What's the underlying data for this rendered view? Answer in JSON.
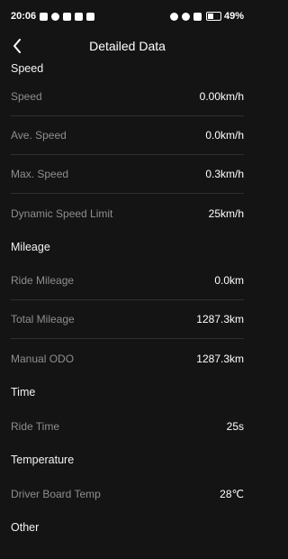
{
  "status_bar": {
    "time": "20:06",
    "battery": "49%"
  },
  "header": {
    "title": "Detailed Data"
  },
  "sections": [
    {
      "title": "Speed",
      "rows": [
        {
          "label": "Speed",
          "value": "0.00km/h"
        },
        {
          "label": "Ave. Speed",
          "value": "0.0km/h"
        },
        {
          "label": "Max. Speed",
          "value": "0.3km/h"
        },
        {
          "label": "Dynamic Speed Limit",
          "value": "25km/h"
        }
      ]
    },
    {
      "title": "Mileage",
      "rows": [
        {
          "label": "Ride Mileage",
          "value": "0.0km"
        },
        {
          "label": "Total Mileage",
          "value": "1287.3km"
        },
        {
          "label": "Manual ODO",
          "value": "1287.3km"
        }
      ]
    },
    {
      "title": "Time",
      "rows": [
        {
          "label": "Ride Time",
          "value": "25s"
        }
      ]
    },
    {
      "title": "Temperature",
      "rows": [
        {
          "label": "Driver Board Temp",
          "value": "28℃"
        }
      ]
    },
    {
      "title": "Other",
      "rows": []
    }
  ]
}
